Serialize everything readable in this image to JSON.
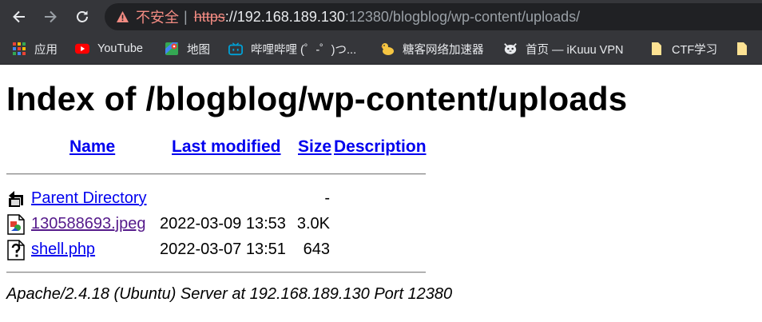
{
  "browser": {
    "security_label": "不安全",
    "url_scheme": "https",
    "url_sep": "://",
    "url_host": "192.168.189.130",
    "url_rest": ":12380/blogblog/wp-content/uploads/",
    "icons": [
      "back-arrow-icon",
      "forward-arrow-icon",
      "reload-icon",
      "warning-triangle-icon"
    ]
  },
  "bookmarks": [
    {
      "label": "应用",
      "icon": "apps-grid-icon"
    },
    {
      "label": "YouTube",
      "icon": "youtube-icon"
    },
    {
      "label": "地图",
      "icon": "maps-icon"
    },
    {
      "label": "哔哩哔哩 (゜-゜)つ...",
      "icon": "bilibili-icon"
    },
    {
      "label": "糖客网络加速器",
      "icon": "duck-icon"
    },
    {
      "label": "首页 — iKuuu VPN",
      "icon": "cat-icon"
    },
    {
      "label": "CTF学习",
      "icon": "folder-icon"
    },
    {
      "label": "",
      "icon": "folder-icon"
    }
  ],
  "page": {
    "title": "Index of /blogblog/wp-content/uploads",
    "columns": {
      "name": "Name",
      "last_modified": "Last modified",
      "size": "Size",
      "description": "Description"
    },
    "rows": [
      {
        "name": "Parent Directory",
        "date": "",
        "size": "-",
        "icon": "back-folder-icon"
      },
      {
        "name": "130588693.jpeg",
        "date": "2022-03-09 13:53",
        "size": "3.0K",
        "icon": "image-file-icon"
      },
      {
        "name": "shell.php",
        "date": "2022-03-07 13:51",
        "size": "643",
        "icon": "unknown-file-icon"
      }
    ],
    "address": "Apache/2.4.18 (Ubuntu) Server at 192.168.189.130 Port 12380"
  }
}
